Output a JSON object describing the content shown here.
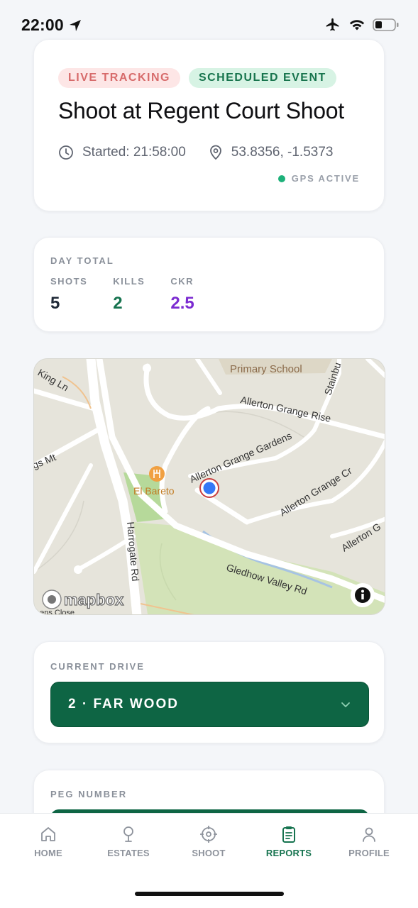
{
  "status_bar": {
    "time": "22:00"
  },
  "event": {
    "badge_live": "LIVE TRACKING",
    "badge_scheduled": "SCHEDULED EVENT",
    "title": "Shoot at Regent Court Shoot",
    "started": "Started: 21:58:00",
    "coordinates": "53.8356, -1.5373",
    "gps_status": "GPS ACTIVE"
  },
  "day_total": {
    "label": "DAY TOTAL",
    "shots_label": "SHOTS",
    "shots_value": "5",
    "kills_label": "KILLS",
    "kills_value": "2",
    "ckr_label": "CKR",
    "ckr_value": "2.5"
  },
  "map": {
    "labels": {
      "primary_school": "Primary School",
      "king_ln": "King Ln",
      "stainburn": "Stainbu",
      "allerton_grange_rise": "Allerton Grange Rise",
      "allerton_grange_gardens": "Allerton Grange Gardens",
      "gs_mt": "gs Mt",
      "el_bareto": "El Bareto",
      "allerton_grange_cr": "Allerton Grange Cr",
      "allerton_g": "Allerton G",
      "harrogate_rd": "Harrogate Rd",
      "gledhow_valley_rd": "Gledhow Valley Rd",
      "eens_close": "eens Close",
      "mapbox": "mapbox"
    },
    "colors": {
      "land": "#e6e4db",
      "park": "#cfe0b4",
      "road": "#ffffff",
      "water": "#a6c3e3",
      "location": "#3478f6"
    }
  },
  "current_drive": {
    "label": "CURRENT DRIVE",
    "value": "2 · FAR WOOD"
  },
  "peg": {
    "label": "PEG NUMBER"
  },
  "tabs": [
    {
      "label": "HOME",
      "icon": "home-icon",
      "active": false
    },
    {
      "label": "ESTATES",
      "icon": "tree-icon",
      "active": false
    },
    {
      "label": "SHOOT",
      "icon": "crosshair-icon",
      "active": false
    },
    {
      "label": "REPORTS",
      "icon": "clipboard-icon",
      "active": true
    },
    {
      "label": "PROFILE",
      "icon": "person-icon",
      "active": false
    }
  ],
  "colors": {
    "accent": "#0e6544",
    "live": "#d76b6b",
    "ckr": "#7b2bd1",
    "gps": "#1db17a"
  }
}
